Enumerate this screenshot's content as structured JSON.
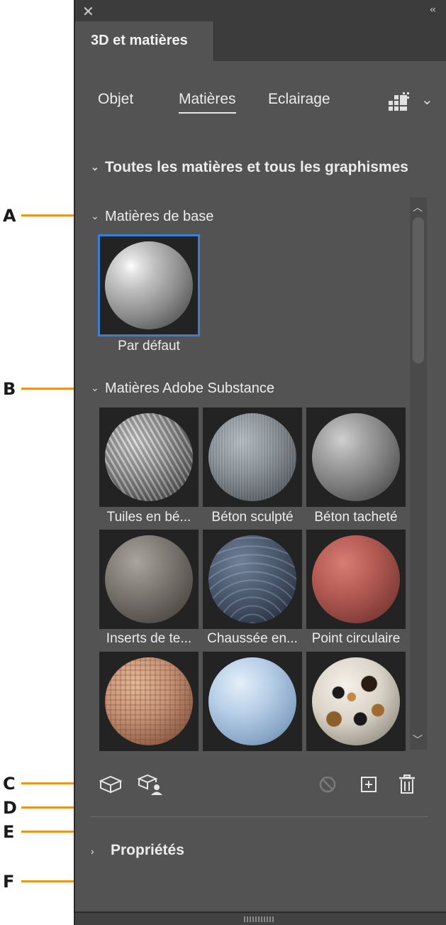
{
  "callouts": [
    "A",
    "B",
    "C",
    "D",
    "E",
    "F"
  ],
  "panel": {
    "title": "3D et matières",
    "close_icon": "close-icon",
    "collapse_icon": "double-chevron-left-icon"
  },
  "subtabs": [
    {
      "label": "Objet"
    },
    {
      "label": "Matières",
      "active": true
    },
    {
      "label": "Eclairage"
    }
  ],
  "all_section": {
    "label": "Toutes les matières et tous les graphismes"
  },
  "base_section": {
    "label": "Matières de base",
    "items": [
      {
        "label": "Par défaut",
        "selected": true
      }
    ]
  },
  "substance_section": {
    "label": "Matières Adobe Substance",
    "items": [
      {
        "label": "Tuiles en bé..."
      },
      {
        "label": "Béton sculpté"
      },
      {
        "label": "Béton tacheté"
      },
      {
        "label": "Inserts de te..."
      },
      {
        "label": "Chaussée en..."
      },
      {
        "label": "Point circulaire"
      },
      {
        "label": ""
      },
      {
        "label": ""
      },
      {
        "label": ""
      }
    ]
  },
  "toolbar": {
    "icons": [
      "cube-icon",
      "cube-user-icon",
      "prohibited-icon",
      "add-square-icon",
      "trash-icon"
    ]
  },
  "properties": {
    "label": "Propriétés"
  },
  "colors": {
    "panel_bg": "#535353",
    "header_bg": "#3c3c3c",
    "selection": "#3a7fd1",
    "callout_line": "#f0921e"
  }
}
